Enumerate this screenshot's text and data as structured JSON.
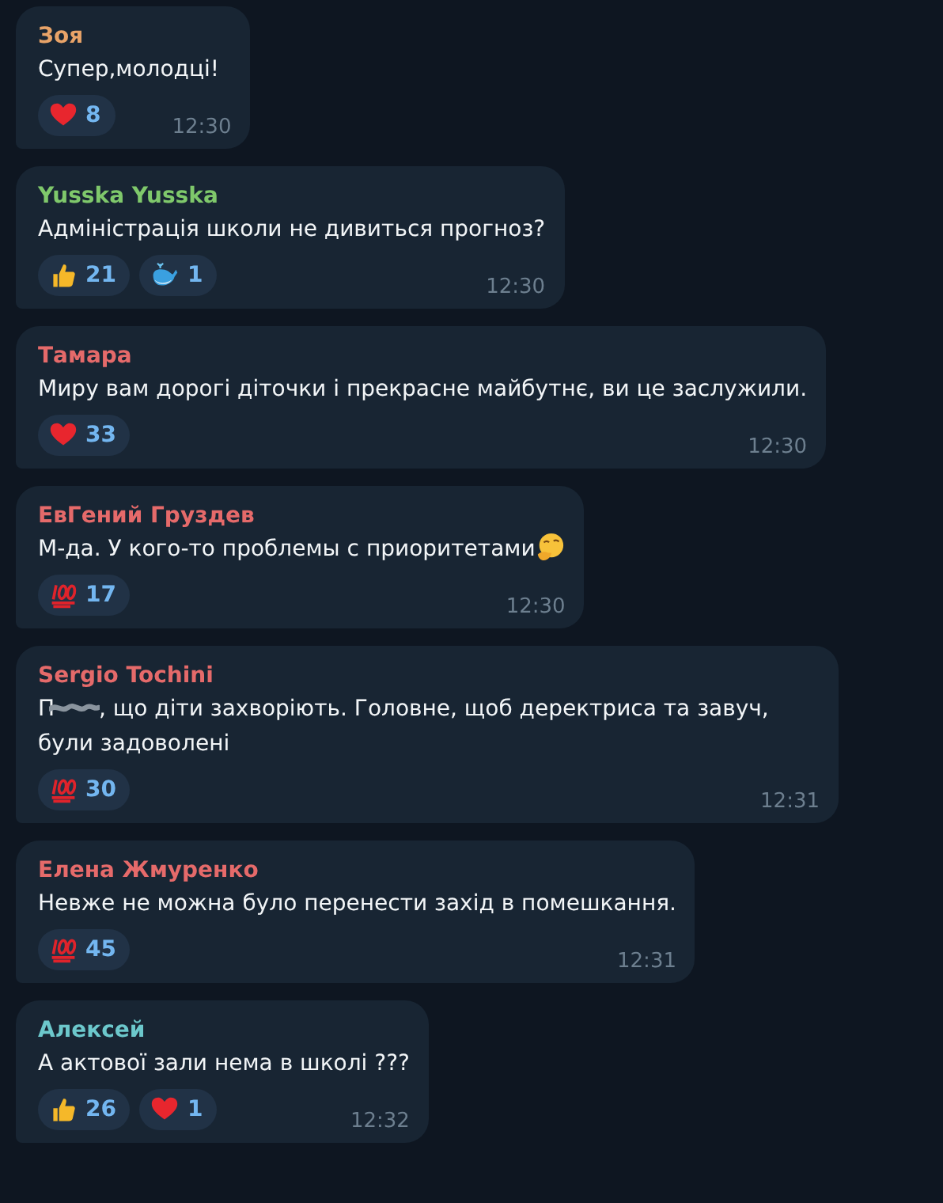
{
  "messages": [
    {
      "author": "Зоя",
      "color": "#e8a368",
      "text_parts": [
        "Супер,молодці!"
      ],
      "reactions": [
        {
          "kind": "heart",
          "count": "8"
        }
      ],
      "time": "12:30"
    },
    {
      "author": "Yusska Yusska",
      "color": "#7fc86b",
      "text_parts": [
        "Адміністрація школи не дивиться прогноз?"
      ],
      "reactions": [
        {
          "kind": "thumbs-up",
          "count": "21"
        },
        {
          "kind": "whale",
          "count": "1"
        }
      ],
      "time": "12:30"
    },
    {
      "author": "Тамара",
      "color": "#e56a6a",
      "text_parts": [
        "Миру вам дорогі діточки і прекрасне майбутнє, ви це заслужили."
      ],
      "reactions": [
        {
          "kind": "heart",
          "count": "33"
        }
      ],
      "time": "12:30"
    },
    {
      "author": "ЕвГений Груздев",
      "color": "#e56a6a",
      "text_parts": [
        "М-да. У кого-то проблемы с приоритетами"
      ],
      "trailing_icon": {
        "kind": "thinking"
      },
      "reactions": [
        {
          "kind": "hundred",
          "count": "17"
        }
      ],
      "time": "12:30"
    },
    {
      "author": "Sergio Tochini",
      "color": "#e56a6a",
      "text_parts": [
        "П",
        ", що діти захворіють. Головне, щоб деректриса та завуч, були задоволені"
      ],
      "redacted": true,
      "reactions": [
        {
          "kind": "hundred",
          "count": "30"
        }
      ],
      "time": "12:31"
    },
    {
      "author": "Елена Жмуренко",
      "color": "#e56a6a",
      "text_parts": [
        "Невже не можна було перенести захід в помешкання."
      ],
      "reactions": [
        {
          "kind": "hundred",
          "count": "45"
        }
      ],
      "time": "12:31"
    },
    {
      "author": "Алексей",
      "color": "#6cc8cc",
      "text_parts": [
        "А актової зали нема в школі ???"
      ],
      "reactions": [
        {
          "kind": "thumbs-up",
          "count": "26"
        },
        {
          "kind": "heart",
          "count": "1"
        }
      ],
      "time": "12:32"
    }
  ]
}
